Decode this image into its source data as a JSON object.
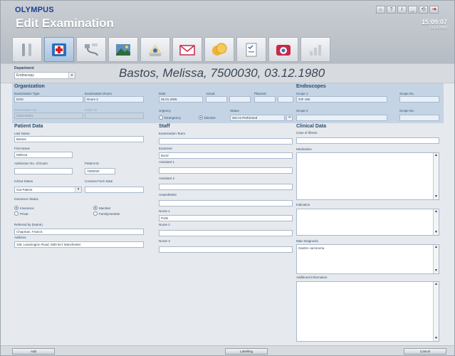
{
  "app": {
    "logo": "OLYMPUS",
    "title": "Edit Examination"
  },
  "window_buttons": [
    "⌂",
    "?",
    "i",
    "_",
    "⟲",
    "⇥"
  ],
  "clock": {
    "time": "15:09:07",
    "date": "11.03.2009"
  },
  "toolbar_icons": [
    "tools-icon",
    "medical-cross-icon",
    "endoscope-icon",
    "image-icon",
    "patient-icon",
    "mail-icon",
    "coins-icon",
    "checklist-icon",
    "camera-icon",
    "chart-icon"
  ],
  "department": {
    "label": "Department",
    "value": "Endoscopy"
  },
  "patient_header": "Bastos, Melissa, 7500030, 03.12.1980",
  "organization": {
    "heading": "Organization",
    "exam_type_label": "Examination Type",
    "exam_type": "EGD",
    "exam_room_label": "Examination Room",
    "exam_room": "Room 2",
    "exam_no_label": "Examination No.",
    "exam_no": "2005-00001",
    "order_id_label": "Order ID",
    "order_id": "",
    "date_label": "Date",
    "date": "06.01.2005",
    "actual_label": "Actual",
    "planned_label": "Planned",
    "urgency_label": "Urgency",
    "emergency": "Emergency",
    "elective": "Elective",
    "status_label": "Status",
    "status": "Set As Performed"
  },
  "patient": {
    "heading": "Patient Data",
    "last_name_label": "Last Name",
    "last_name": "Bastos",
    "first_name_label": "First Name",
    "first_name": "Melissa",
    "admission_label": "Admission No. of Exam.",
    "admission": "",
    "patient_id_label": "Patient ID",
    "patient_id": "7500030",
    "inout_label": "In/Out Status",
    "inout": "Out Patient",
    "consent_label": "Consent Form Date",
    "consent": "",
    "insurance_label": "Insurance Status",
    "insurance": "Insurance",
    "privat": "Privat",
    "member": "Member",
    "familymember": "Familymember",
    "referred_label": "Referred by (Name)",
    "referred": "Chapman, Francis",
    "address_label": "Address",
    "address": "108, Leamington Road, M30 9LY Manchester"
  },
  "staff": {
    "heading": "Staff",
    "team_label": "Examination Team",
    "team": "",
    "examiner_label": "Examiner",
    "examiner": "Bond",
    "assistant1_label": "Assistant 1",
    "assistant1": "",
    "assistant2_label": "Assistant 2",
    "assistant2": "",
    "anaesthetist_label": "Anaesthetist",
    "anaesthetist": "",
    "nurse1_label": "Nurse 1",
    "nurse1": "Potts",
    "nurse2_label": "Nurse 2",
    "nurse2": "",
    "nurse3_label": "Nurse 3",
    "nurse3": ""
  },
  "endoscopes": {
    "heading": "Endoscopes",
    "scope1_label": "Scope 1",
    "scope1": "GIF-160",
    "scope_no_label": "Scope No.",
    "scope1_no": "",
    "scope2_label": "Scope 2",
    "scope2": "",
    "scope2_no": ""
  },
  "clinical": {
    "heading": "Clinical Data",
    "case_label": "Case of Illness",
    "case": "",
    "medication_label": "Medication",
    "medication": "",
    "indication_label": "Indication",
    "indication": "",
    "diagnosis_label": "Main Diagnosis",
    "diagnosis": "Gastric carcinoma",
    "additional_label": "Additional Information",
    "additional": ""
  },
  "buttons": {
    "add": "Add",
    "labelling": "Labelling",
    "cancel": "Cancel"
  }
}
